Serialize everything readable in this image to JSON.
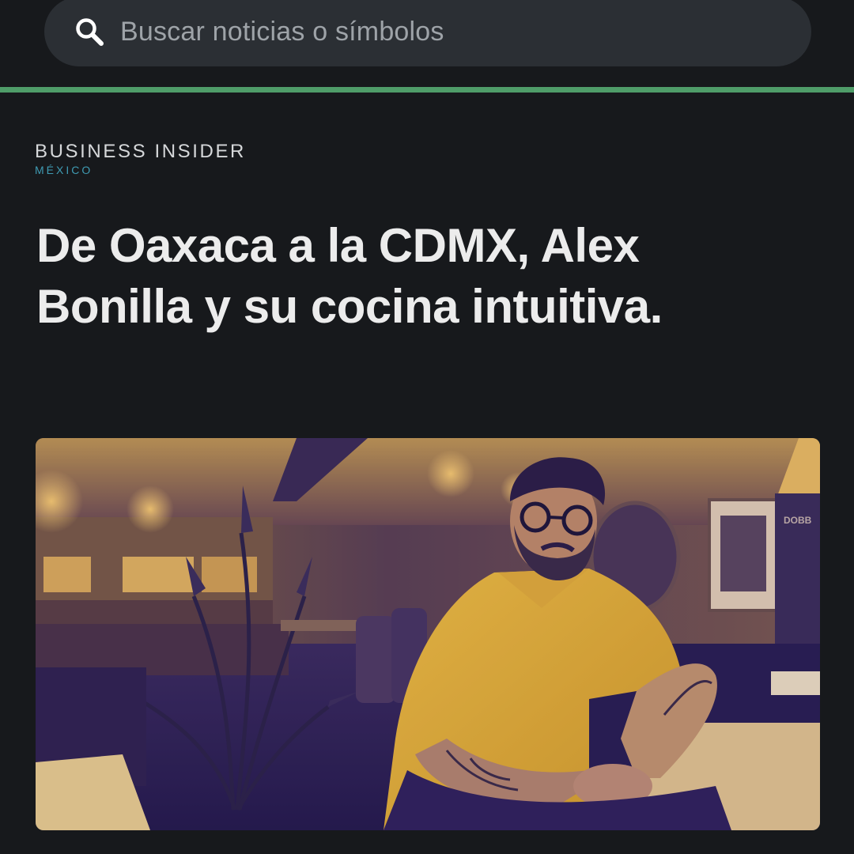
{
  "search": {
    "placeholder": "Buscar noticias o símbolos",
    "icon": "search-icon"
  },
  "colors": {
    "background": "#17191c",
    "accent": "#4f9d69",
    "logo_sub": "#3f9bb3"
  },
  "publication": {
    "name": "BUSINESS INSIDER",
    "edition": "MÉXICO"
  },
  "article": {
    "headline": "De Oaxaca a la CDMX, Alex Bonilla y su cocina intuitiva."
  },
  "hero_image": {
    "description_icon": "chef-photo",
    "poster_text": "DOBB"
  }
}
